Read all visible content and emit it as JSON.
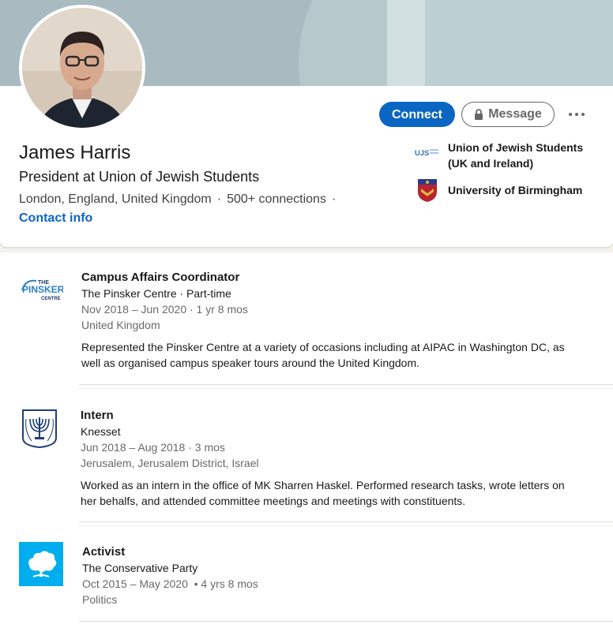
{
  "profile": {
    "name": "James Harris",
    "headline": "President at Union of Jewish Students",
    "location": "London, England, United Kingdom",
    "connections": "500+ connections",
    "separator": "·",
    "contact_info": "Contact info"
  },
  "actions": {
    "connect": "Connect",
    "message": "Message"
  },
  "organizations": [
    {
      "name": "Union of Jewish Students (UK and Ireland)",
      "logo_text": "UJS"
    },
    {
      "name": "University of Birmingham"
    }
  ],
  "experience": [
    {
      "title": "Campus Affairs Coordinator",
      "company": "The Pinsker Centre · Part-time",
      "dates": "Nov 2018 – Jun 2020 · 1 yr 8 mos",
      "location": "United Kingdom",
      "description": "Represented the Pinsker Centre at a variety of occasions including at AIPAC in Washington DC, as well as organised campus speaker tours around the United Kingdom.",
      "logo_text": [
        "THE",
        "PINSKER",
        "CENTRE"
      ]
    },
    {
      "title": "Intern",
      "company": "Knesset",
      "dates": "Jun 2018 – Aug 2018 · 3 mos",
      "location": "Jerusalem, Jerusalem District, Israel",
      "description": "Worked as an intern in the office of MK Sharren Haskel. Performed research tasks, wrote letters on her behalfs, and attended committee meetings and meetings with constituents."
    },
    {
      "title": "Activist",
      "company": "The Conservative Party",
      "dates": "Oct 2015 – May 2020  • 4 yrs 8 mos",
      "location": "Politics",
      "description": ""
    }
  ],
  "colors": {
    "accent": "#0a66c2",
    "cover": "#a9bbc0",
    "conservative": "#00aeef"
  },
  "icons": [
    "lock-icon",
    "more-icon"
  ]
}
